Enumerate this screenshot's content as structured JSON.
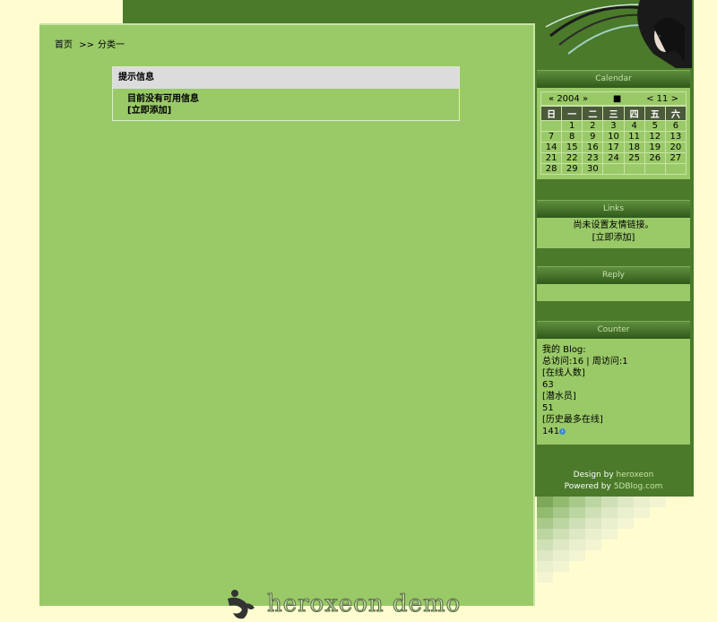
{
  "breadcrumb": {
    "home": "首页",
    "sep": ">>",
    "current": "分类一"
  },
  "notice": {
    "title": "提示信息",
    "message": "目前没有可用信息",
    "add_link": "[立即添加]"
  },
  "calendar": {
    "title": "Calendar",
    "prev_year": "«",
    "year": "2004",
    "next_year": "»",
    "today_marker": "■",
    "prev_month": "<",
    "month": "11",
    "next_month": ">",
    "weekdays": [
      "日",
      "一",
      "二",
      "三",
      "四",
      "五",
      "六"
    ],
    "weeks": [
      [
        "",
        "1",
        "2",
        "3",
        "4",
        "5",
        "6"
      ],
      [
        "7",
        "8",
        "9",
        "10",
        "11",
        "12",
        "13"
      ],
      [
        "14",
        "15",
        "16",
        "17",
        "18",
        "19",
        "20"
      ],
      [
        "21",
        "22",
        "23",
        "24",
        "25",
        "26",
        "27"
      ],
      [
        "28",
        "29",
        "30",
        "",
        "",
        "",
        ""
      ]
    ]
  },
  "links": {
    "title": "Links",
    "empty_text": "尚未设置友情链接。",
    "add_link": "[立即添加]"
  },
  "reply": {
    "title": "Reply"
  },
  "counter": {
    "title": "Counter",
    "my_blog": "我的 Blog:",
    "visits": "总访问:16 | 周访问:1",
    "online_label": "[在线人数]",
    "online_value": "63",
    "lurkers_label": "[潜水员]",
    "lurkers_value": "51",
    "max_label": "[历史最多在线]",
    "max_value": "141"
  },
  "footer": {
    "design_prefix": "Design by",
    "designer": "heroxeon",
    "powered_prefix": "Powered by",
    "powered_by": "5DBlog.com"
  },
  "logo": {
    "text": "heroxeon demo"
  },
  "colors": {
    "background": "#fffdd0",
    "main_green": "#9aca68",
    "dark_green": "#4a7a2a",
    "light_green": "#c9e3a6"
  }
}
